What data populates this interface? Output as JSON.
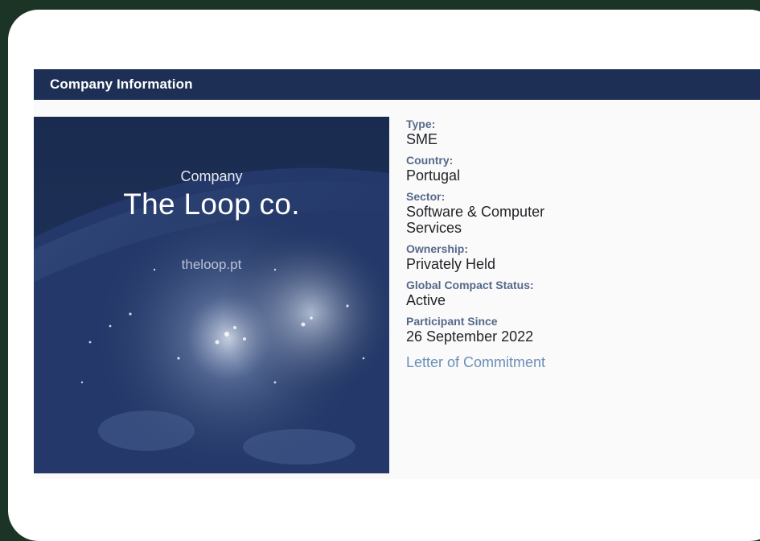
{
  "section": {
    "title": "Company Information"
  },
  "hero": {
    "overline": "Company",
    "name": "The Loop co.",
    "domain": "theloop.pt"
  },
  "fields": [
    {
      "label": "Type:",
      "value": "SME"
    },
    {
      "label": "Country:",
      "value": "Portugal"
    },
    {
      "label": "Sector:",
      "value": "Software & Computer Services"
    },
    {
      "label": "Ownership:",
      "value": "Privately Held"
    },
    {
      "label": "Global Compact Status:",
      "value": "Active"
    },
    {
      "label": "Participant Since",
      "value": "26 September 2022"
    }
  ],
  "link": {
    "label": "Letter of Commitment"
  },
  "colors": {
    "background": "#1c3426",
    "header": "#1d2f55",
    "label": "#56698a",
    "link": "#6b8fb8"
  }
}
